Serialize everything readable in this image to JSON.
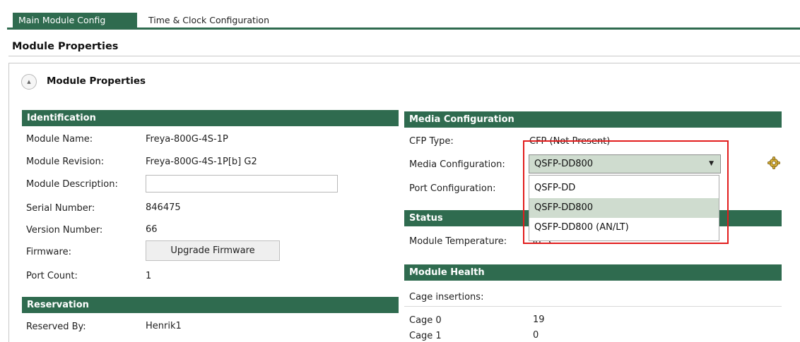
{
  "tabs": {
    "main_module_config": "Main Module Config",
    "time_clock_config": "Time & Clock Configuration"
  },
  "header": {
    "title": "Module Properties"
  },
  "module_properties": {
    "title": "Module Properties"
  },
  "identification": {
    "header": "Identification",
    "module_name_label": "Module Name:",
    "module_name_value": "Freya-800G-4S-1P",
    "module_revision_label": "Module Revision:",
    "module_revision_value": "Freya-800G-4S-1P[b] G2",
    "module_description_label": "Module Description:",
    "module_description_value": "",
    "serial_number_label": "Serial Number:",
    "serial_number_value": "846475",
    "version_number_label": "Version Number:",
    "version_number_value": "66",
    "firmware_label": "Firmware:",
    "upgrade_firmware_button": "Upgrade Firmware",
    "port_count_label": "Port Count:",
    "port_count_value": "1"
  },
  "reservation": {
    "header": "Reservation",
    "reserved_by_label": "Reserved By:",
    "reserved_by_value": "Henrik1"
  },
  "media_configuration": {
    "header": "Media Configuration",
    "cfp_type_label": "CFP Type:",
    "cfp_type_value": "CFP (Not Present)",
    "media_configuration_label": "Media Configuration:",
    "media_configuration_value": "QSFP-DD800",
    "port_configuration_label": "Port Configuration:",
    "options": [
      "QSFP-DD",
      "QSFP-DD800",
      "QSFP-DD800 (AN/LT)"
    ]
  },
  "status": {
    "header": "Status",
    "module_temperature_label": "Module Temperature:",
    "module_temperature_value": "38 °C"
  },
  "module_health": {
    "header": "Module Health",
    "cage_insertions_label": "Cage insertions:",
    "cages": [
      {
        "name": "Cage 0",
        "value": "19"
      },
      {
        "name": "Cage 1",
        "value": "0"
      }
    ]
  },
  "colors": {
    "accent_green": "#2f6b4f",
    "selection_green": "#cfdccf",
    "highlight_red": "#e21d1d"
  },
  "icons": {
    "collapse": "chevron-up-icon",
    "dropdown": "chevron-down-icon",
    "settings": "gear-icon"
  }
}
